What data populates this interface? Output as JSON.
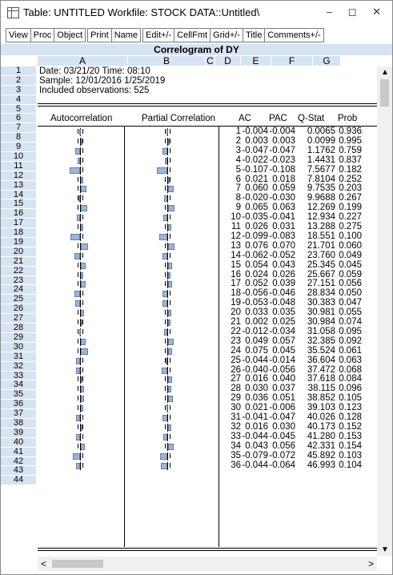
{
  "window": {
    "title": "Table: UNTITLED   Workfile: STOCK DATA::Untitled\\",
    "controls": "– ◻ ✕"
  },
  "toolbar": {
    "group1": [
      "View",
      "Proc",
      "Object"
    ],
    "group2": [
      "Print",
      "Name"
    ],
    "group3": [
      "Edit+/-",
      "CellFmt",
      "Grid+/-",
      "Title",
      "Comments+/-"
    ]
  },
  "sheet_title": "Correlogram of DY",
  "columns": [
    "A",
    "B",
    "C",
    "D",
    "E",
    "F",
    "G"
  ],
  "rows": [
    "1",
    "2",
    "3",
    "4",
    "5",
    "6",
    "7",
    "8",
    "9",
    "10",
    "11",
    "12",
    "13",
    "14",
    "15",
    "16",
    "17",
    "18",
    "19",
    "20",
    "21",
    "22",
    "23",
    "24",
    "25",
    "26",
    "27",
    "28",
    "29",
    "30",
    "31",
    "32",
    "33",
    "34",
    "35",
    "36",
    "37",
    "38",
    "39",
    "40",
    "41",
    "42",
    "43",
    "44"
  ],
  "header": {
    "date": "Date: 03/21/20   Time: 08:10",
    "sample": "Sample: 12/01/2016 1/25/2019",
    "obs": "Included observations: 525"
  },
  "table_headers": [
    "Autocorrelation",
    "Partial Correlation",
    "AC",
    "PAC",
    "Q-Stat",
    "Prob"
  ],
  "correlogram": [
    [
      "1",
      "-0.004",
      "-0.004",
      "0.0065",
      "0.936"
    ],
    [
      "2",
      "0.003",
      "0.003",
      "0.0099",
      "0.995"
    ],
    [
      "3",
      "-0.047",
      "-0.047",
      "1.1762",
      "0.759"
    ],
    [
      "4",
      "-0.022",
      "-0.023",
      "1.4431",
      "0.837"
    ],
    [
      "5",
      "-0.107",
      "-0.108",
      "7.5677",
      "0.182"
    ],
    [
      "6",
      "0.021",
      "0.018",
      "7.8104",
      "0.252"
    ],
    [
      "7",
      "0.060",
      "0.059",
      "9.7535",
      "0.203"
    ],
    [
      "8",
      "-0.020",
      "-0.030",
      "9.9688",
      "0.267"
    ],
    [
      "9",
      "0.065",
      "0.063",
      "12.269",
      "0.199"
    ],
    [
      "10",
      "-0.035",
      "-0.041",
      "12.934",
      "0.227"
    ],
    [
      "11",
      "0.026",
      "0.031",
      "13.288",
      "0.275"
    ],
    [
      "12",
      "-0.099",
      "-0.083",
      "18.551",
      "0.100"
    ],
    [
      "13",
      "0.076",
      "0.070",
      "21.701",
      "0.060"
    ],
    [
      "14",
      "-0.062",
      "-0.052",
      "23.760",
      "0.049"
    ],
    [
      "15",
      "0.054",
      "0.043",
      "25.345",
      "0.045"
    ],
    [
      "16",
      "0.024",
      "0.026",
      "25.667",
      "0.059"
    ],
    [
      "17",
      "0.052",
      "0.039",
      "27.151",
      "0.056"
    ],
    [
      "18",
      "-0.056",
      "-0.046",
      "28.834",
      "0.050"
    ],
    [
      "19",
      "-0.053",
      "-0.048",
      "30.383",
      "0.047"
    ],
    [
      "20",
      "0.033",
      "0.035",
      "30.981",
      "0.055"
    ],
    [
      "21",
      "0.002",
      "0.025",
      "30.984",
      "0.074"
    ],
    [
      "22",
      "-0.012",
      "-0.034",
      "31.058",
      "0.095"
    ],
    [
      "23",
      "0.049",
      "0.057",
      "32.385",
      "0.092"
    ],
    [
      "24",
      "0.075",
      "0.045",
      "35.524",
      "0.061"
    ],
    [
      "25",
      "-0.044",
      "-0.014",
      "36.604",
      "0.063"
    ],
    [
      "26",
      "-0.040",
      "-0.056",
      "37.472",
      "0.068"
    ],
    [
      "27",
      "0.016",
      "0.040",
      "37.618",
      "0.084"
    ],
    [
      "28",
      "0.030",
      "0.037",
      "38.115",
      "0.096"
    ],
    [
      "29",
      "0.036",
      "0.051",
      "38.852",
      "0.105"
    ],
    [
      "30",
      "0.021",
      "-0.006",
      "39.103",
      "0.123"
    ],
    [
      "31",
      "-0.041",
      "-0.047",
      "40.026",
      "0.128"
    ],
    [
      "32",
      "0.016",
      "0.030",
      "40.173",
      "0.152"
    ],
    [
      "33",
      "-0.044",
      "-0.045",
      "41.280",
      "0.153"
    ],
    [
      "34",
      "0.043",
      "0.056",
      "42.331",
      "0.154"
    ],
    [
      "35",
      "-0.079",
      "-0.072",
      "45.892",
      "0.103"
    ],
    [
      "36",
      "-0.044",
      "-0.064",
      "46.993",
      "0.104"
    ]
  ],
  "colors": {
    "header_bg": "#d6e3f3",
    "bar": "#9fb4d6"
  }
}
